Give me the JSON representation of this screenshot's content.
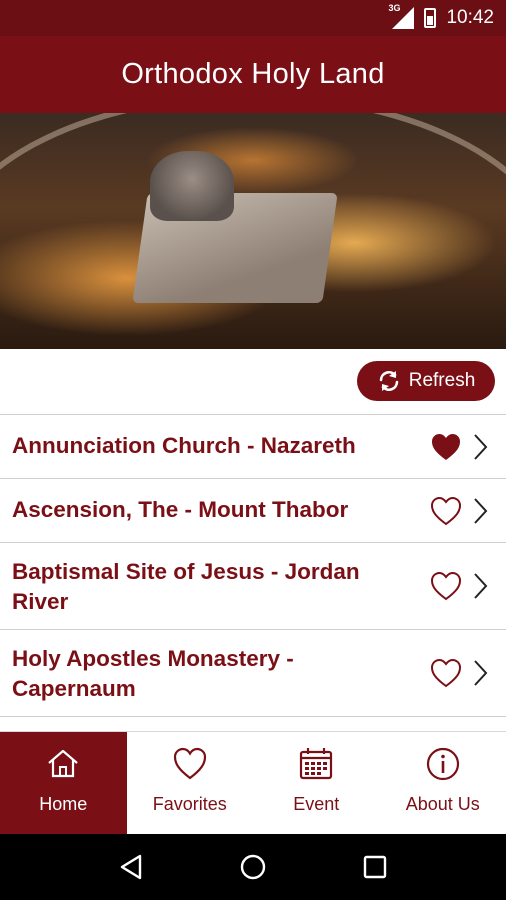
{
  "status_bar": {
    "network": "3G",
    "time": "10:42",
    "icons": [
      "signal-icon",
      "battery-icon"
    ]
  },
  "app_bar": {
    "title": "Orthodox Holy Land"
  },
  "hero": {
    "image": "church-interior-candles"
  },
  "refresh": {
    "label": "Refresh",
    "icon": "refresh-icon"
  },
  "list": {
    "items": [
      {
        "title": "Annunciation Church - Nazareth",
        "favorite": true
      },
      {
        "title": "Ascension, The - Mount Thabor",
        "favorite": false
      },
      {
        "title": "Baptismal Site of Jesus - Jordan River",
        "favorite": false
      },
      {
        "title": "Holy Apostles Monastery - Capernaum",
        "favorite": false
      }
    ]
  },
  "bottom_nav": {
    "items": [
      {
        "label": "Home",
        "icon": "home-icon",
        "active": true
      },
      {
        "label": "Favorites",
        "icon": "heart-icon",
        "active": false
      },
      {
        "label": "Event",
        "icon": "calendar-icon",
        "active": false
      },
      {
        "label": "About Us",
        "icon": "info-icon",
        "active": false
      }
    ]
  },
  "colors": {
    "primary": "#7a1016",
    "status_bar": "#6b0f14",
    "divider": "#cfcfcf"
  }
}
